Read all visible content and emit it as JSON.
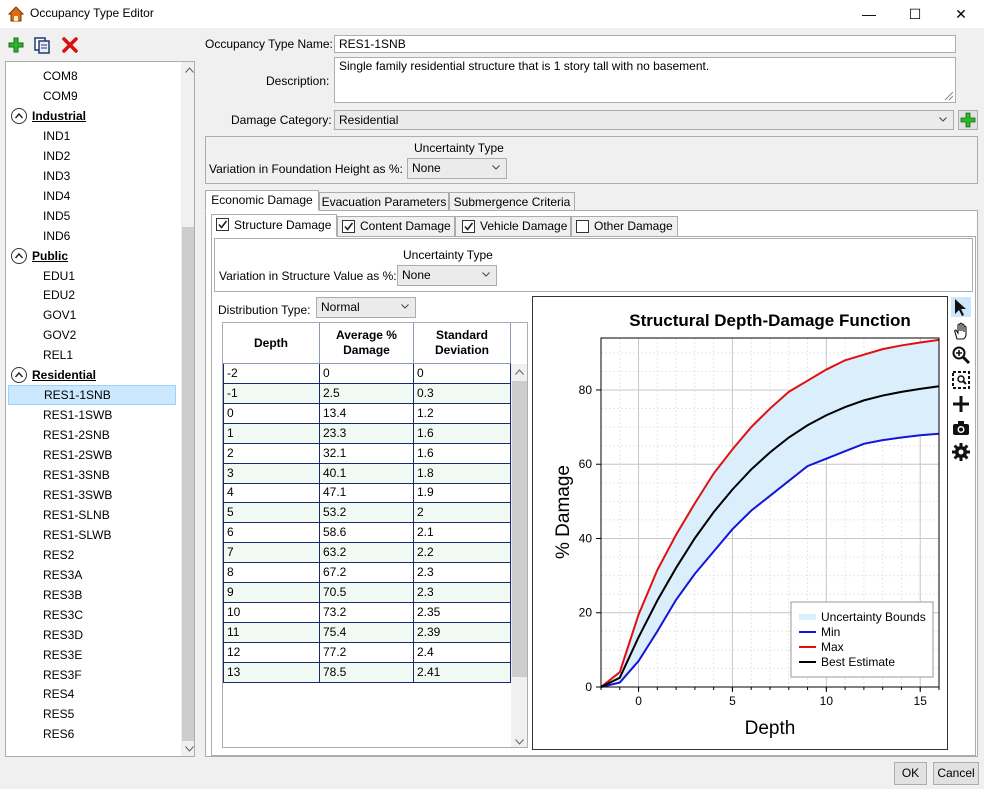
{
  "window": {
    "title": "Occupancy Type Editor",
    "minimize": "—",
    "maximize": "☐",
    "close": "✕"
  },
  "toolbar": {
    "add": "add-icon",
    "copy": "copy-icon",
    "delete": "delete-icon"
  },
  "tree": {
    "items": [
      {
        "label": "COM8",
        "kind": "leaf"
      },
      {
        "label": "COM9",
        "kind": "leaf"
      },
      {
        "label": "Industrial",
        "kind": "category"
      },
      {
        "label": "IND1",
        "kind": "leaf"
      },
      {
        "label": "IND2",
        "kind": "leaf"
      },
      {
        "label": "IND3",
        "kind": "leaf"
      },
      {
        "label": "IND4",
        "kind": "leaf"
      },
      {
        "label": "IND5",
        "kind": "leaf"
      },
      {
        "label": "IND6",
        "kind": "leaf"
      },
      {
        "label": "Public",
        "kind": "category"
      },
      {
        "label": "EDU1",
        "kind": "leaf"
      },
      {
        "label": "EDU2",
        "kind": "leaf"
      },
      {
        "label": "GOV1",
        "kind": "leaf"
      },
      {
        "label": "GOV2",
        "kind": "leaf"
      },
      {
        "label": "REL1",
        "kind": "leaf"
      },
      {
        "label": "Residential",
        "kind": "category"
      },
      {
        "label": "RES1-1SNB",
        "kind": "leaf",
        "selected": true
      },
      {
        "label": "RES1-1SWB",
        "kind": "leaf"
      },
      {
        "label": "RES1-2SNB",
        "kind": "leaf"
      },
      {
        "label": "RES1-2SWB",
        "kind": "leaf"
      },
      {
        "label": "RES1-3SNB",
        "kind": "leaf"
      },
      {
        "label": "RES1-3SWB",
        "kind": "leaf"
      },
      {
        "label": "RES1-SLNB",
        "kind": "leaf"
      },
      {
        "label": "RES1-SLWB",
        "kind": "leaf"
      },
      {
        "label": "RES2",
        "kind": "leaf"
      },
      {
        "label": "RES3A",
        "kind": "leaf"
      },
      {
        "label": "RES3B",
        "kind": "leaf"
      },
      {
        "label": "RES3C",
        "kind": "leaf"
      },
      {
        "label": "RES3D",
        "kind": "leaf"
      },
      {
        "label": "RES3E",
        "kind": "leaf"
      },
      {
        "label": "RES3F",
        "kind": "leaf"
      },
      {
        "label": "RES4",
        "kind": "leaf"
      },
      {
        "label": "RES5",
        "kind": "leaf"
      },
      {
        "label": "RES6",
        "kind": "leaf"
      }
    ]
  },
  "form": {
    "name_label": "Occupancy Type Name:",
    "name_value": "RES1-1SNB",
    "desc_label": "Description:",
    "desc_value": "Single family residential structure that is 1 story tall with no basement.",
    "category_label": "Damage Category:",
    "category_value": "Residential",
    "foundation": {
      "uncertainty_title": "Uncertainty Type",
      "label": "Variation in Foundation Height as %:",
      "value": "None"
    }
  },
  "tabs": [
    {
      "label": "Economic Damage",
      "active": true
    },
    {
      "label": "Evacuation Parameters",
      "active": false
    },
    {
      "label": "Submergence Criteria",
      "active": false
    }
  ],
  "subtabs": [
    {
      "label": "Structure Damage",
      "checked": true,
      "active": true
    },
    {
      "label": "Content Damage",
      "checked": true,
      "active": false
    },
    {
      "label": "Vehicle Damage",
      "checked": true,
      "active": false
    },
    {
      "label": "Other Damage",
      "checked": false,
      "active": false
    }
  ],
  "structure": {
    "uncertainty_title": "Uncertainty Type",
    "label": "Variation in Structure Value as %:",
    "value": "None",
    "dist_label": "Distribution Type:",
    "dist_value": "Normal"
  },
  "table": {
    "headers": [
      "Depth",
      "Average %\nDamage",
      "Standard\nDeviation"
    ],
    "rows": [
      [
        "-2",
        "0",
        "0"
      ],
      [
        "-1",
        "2.5",
        "0.3"
      ],
      [
        "0",
        "13.4",
        "1.2"
      ],
      [
        "1",
        "23.3",
        "1.6"
      ],
      [
        "2",
        "32.1",
        "1.6"
      ],
      [
        "3",
        "40.1",
        "1.8"
      ],
      [
        "4",
        "47.1",
        "1.9"
      ],
      [
        "5",
        "53.2",
        "2"
      ],
      [
        "6",
        "58.6",
        "2.1"
      ],
      [
        "7",
        "63.2",
        "2.2"
      ],
      [
        "8",
        "67.2",
        "2.3"
      ],
      [
        "9",
        "70.5",
        "2.3"
      ],
      [
        "10",
        "73.2",
        "2.35"
      ],
      [
        "11",
        "75.4",
        "2.39"
      ],
      [
        "12",
        "77.2",
        "2.4"
      ],
      [
        "13",
        "78.5",
        "2.41"
      ]
    ]
  },
  "chart_data": {
    "type": "line",
    "title": "Structural Depth-Damage Function",
    "xlabel": "Depth",
    "ylabel": "% Damage",
    "xlim": [
      -2,
      16
    ],
    "ylim": [
      0,
      94
    ],
    "xticks": [
      0,
      5,
      10,
      15
    ],
    "yticks": [
      0,
      20,
      40,
      60,
      80
    ],
    "grid": true,
    "legend": "bottom-right",
    "x": [
      -2,
      -1,
      0,
      1,
      2,
      3,
      4,
      5,
      6,
      7,
      8,
      9,
      10,
      11,
      12,
      13,
      14,
      15,
      16
    ],
    "series": [
      {
        "name": "Min",
        "color": "#1515d8",
        "values": [
          0,
          1.2,
          7,
          15,
          23.5,
          30.5,
          36.5,
          42.5,
          47.5,
          51.5,
          55.5,
          59.5,
          61.5,
          63.5,
          65.5,
          66.5,
          67.2,
          67.8,
          68.2
        ]
      },
      {
        "name": "Max",
        "color": "#e01010",
        "values": [
          0,
          4,
          19.5,
          31.5,
          41,
          49.5,
          57.5,
          64,
          70,
          75,
          79.5,
          82.5,
          85.5,
          88,
          89.5,
          91,
          92,
          92.8,
          93.5
        ]
      },
      {
        "name": "Best Estimate",
        "color": "#000000",
        "values": [
          0,
          2.5,
          13.4,
          23.3,
          32.1,
          40.1,
          47.1,
          53.2,
          58.6,
          63.2,
          67.2,
          70.5,
          73.2,
          75.4,
          77.2,
          78.5,
          79.5,
          80.3,
          81
        ]
      }
    ],
    "band_name": "Uncertainty Bounds",
    "band_color": "#dbeefb"
  },
  "chart_tools": [
    "pointer-icon",
    "pan-hand-icon",
    "zoom-in-icon",
    "zoom-box-icon",
    "crosshair-icon",
    "camera-icon",
    "gear-icon"
  ],
  "buttons": {
    "ok": "OK",
    "cancel": "Cancel"
  }
}
